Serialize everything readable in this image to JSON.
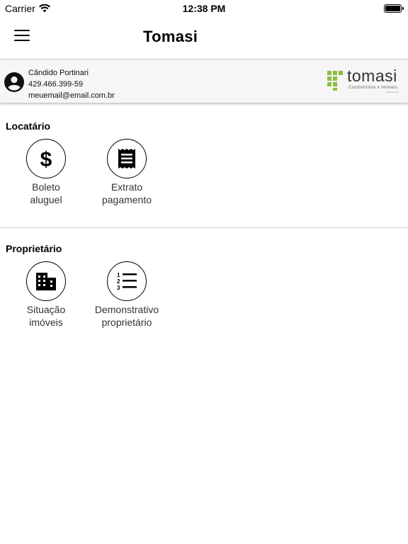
{
  "status_bar": {
    "carrier": "Carrier",
    "time": "12:38 PM"
  },
  "nav": {
    "title": "Tomasi"
  },
  "user": {
    "name": "Cândido Portinari",
    "phone": "429.466.399-59",
    "email": "meuemail@email.com.br"
  },
  "logo": {
    "text": "tomasi",
    "tagline": "Condomínios e Imóveis",
    "small_text": "DESDE 1979",
    "brand_color": "#8cbf3f"
  },
  "sections": [
    {
      "title": "Locatário",
      "items": [
        {
          "label": "Boleto\naluguel",
          "icon": "dollar-icon"
        },
        {
          "label": "Extrato\npagamento",
          "icon": "receipt-icon"
        }
      ]
    },
    {
      "title": "Proprietário",
      "items": [
        {
          "label": "Situação\nimóveis",
          "icon": "building-icon"
        },
        {
          "label": "Demonstrativo\nproprietário",
          "icon": "numbered-list-icon"
        }
      ]
    }
  ]
}
